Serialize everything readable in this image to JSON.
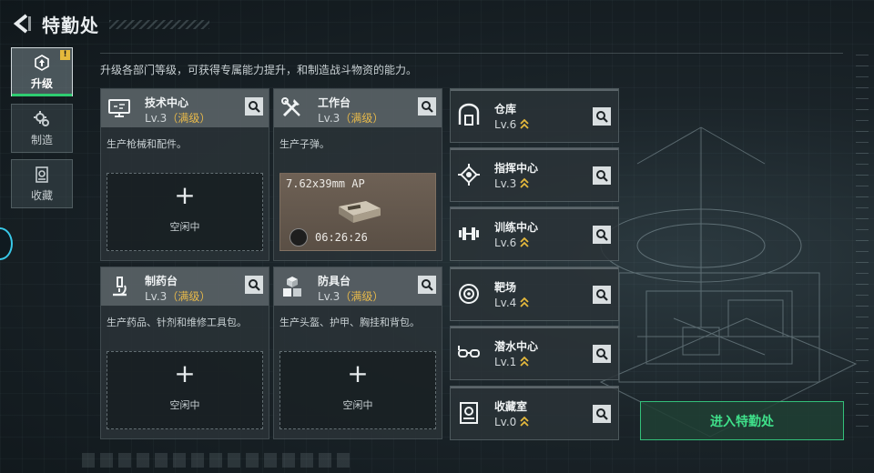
{
  "header": {
    "title": "特勤处"
  },
  "nav": [
    {
      "label": "升级",
      "active": true,
      "badge": "!",
      "icon": "upgrade-icon"
    },
    {
      "label": "制造",
      "active": false,
      "icon": "gears-icon"
    },
    {
      "label": "收藏",
      "active": false,
      "icon": "collection-icon"
    }
  ],
  "description": "升级各部门等级，可获得专属能力提升，和制造战斗物资的能力。",
  "cards": [
    {
      "name": "技术中心",
      "level": "Lv.3",
      "max_label": "（满级）",
      "desc": "生产枪械和配件。",
      "slot_plus": "+",
      "slot_label": "空闲中",
      "icon": "monitor-icon"
    },
    {
      "name": "工作台",
      "level": "Lv.3",
      "max_label": "（满级）",
      "desc": "生产子弹。",
      "busy_item": "7.62x39mm AP",
      "busy_timer": "06:26:26",
      "icon": "tools-icon"
    },
    {
      "name": "制药台",
      "level": "Lv.3",
      "max_label": "（满级）",
      "desc": "生产药品、针剂和维修工具包。",
      "slot_plus": "+",
      "slot_label": "空闲中",
      "icon": "microscope-icon"
    },
    {
      "name": "防具台",
      "level": "Lv.3",
      "max_label": "（满级）",
      "desc": "生产头盔、护甲、胸挂和背包。",
      "slot_plus": "+",
      "slot_label": "空闲中",
      "icon": "cubes-icon"
    }
  ],
  "facilities": [
    {
      "name": "仓库",
      "level": "Lv.6",
      "icon": "warehouse-icon"
    },
    {
      "name": "指挥中心",
      "level": "Lv.3",
      "icon": "chip-icon"
    },
    {
      "name": "训练中心",
      "level": "Lv.6",
      "icon": "dumbbell-icon"
    },
    {
      "name": "靶场",
      "level": "Lv.4",
      "icon": "target-icon"
    },
    {
      "name": "潜水中心",
      "level": "Lv.1",
      "icon": "goggles-icon"
    },
    {
      "name": "收藏室",
      "level": "Lv.0",
      "icon": "vault-icon"
    }
  ],
  "enter_button": "进入特勤处",
  "colors": {
    "accent_green": "#33c07a",
    "max_level_gold": "#e7b94a",
    "upgrade_arrow": "#e5b93c"
  }
}
